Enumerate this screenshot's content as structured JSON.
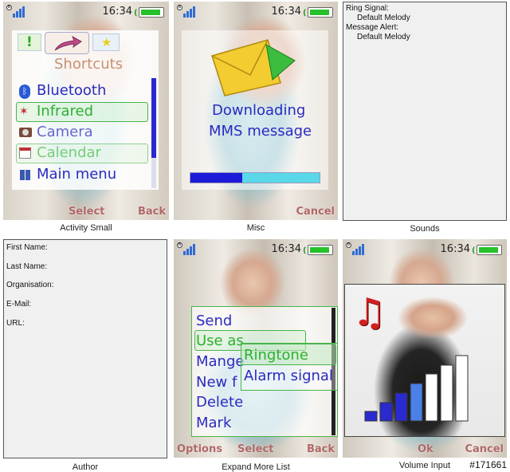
{
  "status": {
    "time": "16:34"
  },
  "cell1": {
    "caption": "Activity Small",
    "tabs": {
      "left_glyph": "!",
      "right_glyph": "★"
    },
    "title": "Shortcuts",
    "items": [
      {
        "label": "Bluetooth",
        "icon": "bluetooth-icon"
      },
      {
        "label": "Infrared",
        "icon": "infrared-icon"
      },
      {
        "label": "Camera",
        "icon": "camera-icon"
      },
      {
        "label": "Calendar",
        "icon": "calendar-icon"
      },
      {
        "label": "Main menu",
        "icon": "grid-icon"
      }
    ],
    "softkeys": {
      "center": "Select",
      "right": "Back"
    }
  },
  "cell2": {
    "caption": "Misc",
    "message_line1": "Downloading",
    "message_line2": "MMS message",
    "progress": 0.4,
    "softkeys": {
      "right": "Cancel"
    }
  },
  "cell3": {
    "caption": "Sounds",
    "lines": [
      "Ring Signal:",
      "Default Melody",
      "Message Alert:",
      "Default Melody"
    ]
  },
  "cell4": {
    "caption": "Author",
    "fields": [
      "First Name:",
      "Last Name:",
      "Organisation:",
      "E-Mail:",
      "URL:"
    ]
  },
  "cell5": {
    "caption": "Expand More List",
    "items": [
      "Send",
      "Use as",
      "Mange",
      "New f",
      "Delete",
      "Mark"
    ],
    "submenu": [
      "Ringtone",
      "Alarm signal"
    ],
    "softkeys": {
      "left": "Options",
      "center": "Select",
      "right": "Back"
    }
  },
  "cell6": {
    "caption": "Volume Input",
    "volume_level": 4,
    "volume_max": 7,
    "softkeys": {
      "center": "Ok",
      "right": "Cancel"
    }
  },
  "watermark": "#171661",
  "colors": {
    "menu_text": "#2a2ac0",
    "selected_text": "#2db12d",
    "softkey": "#b06868",
    "battery": "#27c12b"
  }
}
